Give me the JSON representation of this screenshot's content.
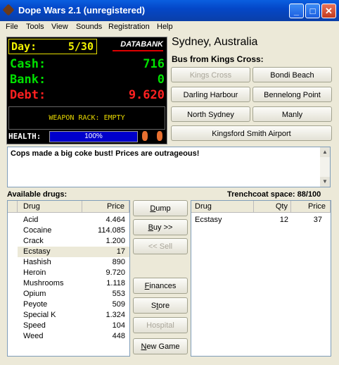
{
  "window": {
    "title": "Dope Wars 2.1 (unregistered)",
    "min_label": "_",
    "max_label": "□",
    "close_label": "✕"
  },
  "menu": [
    "File",
    "Tools",
    "View",
    "Sounds",
    "Registration",
    "Help"
  ],
  "hud": {
    "day_label": "Day:",
    "day_value": "5/30",
    "databank_label": "DATABANK",
    "cash_label": "Cash:",
    "cash_value": "716",
    "bank_label": "Bank:",
    "bank_value": "0",
    "debt_label": "Debt:",
    "debt_value": "9.620",
    "weapon_rack": "WEAPON RACK: EMPTY",
    "health_label": "HEALTH:",
    "health_text": "100%",
    "health_percent": 100,
    "colors": {
      "cash": "#00e000",
      "debt": "#ff2020",
      "day": "#f0f000"
    }
  },
  "location": "Sydney, Australia",
  "bus_from": "Bus from Kings Cross:",
  "destinations": [
    {
      "label": "Kings Cross",
      "enabled": false
    },
    {
      "label": "Bondi Beach",
      "enabled": true
    },
    {
      "label": "Darling Harbour",
      "enabled": true
    },
    {
      "label": "Bennelong Point",
      "enabled": true
    },
    {
      "label": "North Sydney",
      "enabled": true
    },
    {
      "label": "Manly",
      "enabled": true
    },
    {
      "label": "Kingsford Smith Airport",
      "enabled": true
    }
  ],
  "message": "Cops made a big coke bust! Prices are outrageous!",
  "available": {
    "label": "Available drugs:",
    "headers": {
      "drug": "Drug",
      "price": "Price"
    },
    "rows": [
      {
        "drug": "Acid",
        "price": "4.464"
      },
      {
        "drug": "Cocaine",
        "price": "114.085"
      },
      {
        "drug": "Crack",
        "price": "1.200"
      },
      {
        "drug": "Ecstasy",
        "price": "17"
      },
      {
        "drug": "Hashish",
        "price": "890"
      },
      {
        "drug": "Heroin",
        "price": "9.720"
      },
      {
        "drug": "Mushrooms",
        "price": "1.118"
      },
      {
        "drug": "Opium",
        "price": "553"
      },
      {
        "drug": "Peyote",
        "price": "509"
      },
      {
        "drug": "Special K",
        "price": "1.324"
      },
      {
        "drug": "Speed",
        "price": "104"
      },
      {
        "drug": "Weed",
        "price": "448"
      }
    ]
  },
  "actions": {
    "dump": "Dump",
    "buy": "Buy >>",
    "sell": "<< Sell",
    "finances": "Finances",
    "store": "Store",
    "hospital": "Hospital",
    "new_game": "New Game"
  },
  "trenchcoat": {
    "label": "Trenchcoat space: 88/100",
    "headers": {
      "drug": "Drug",
      "qty": "Qty",
      "price": "Price"
    },
    "rows": [
      {
        "drug": "Ecstasy",
        "qty": "12",
        "price": "37"
      }
    ]
  }
}
